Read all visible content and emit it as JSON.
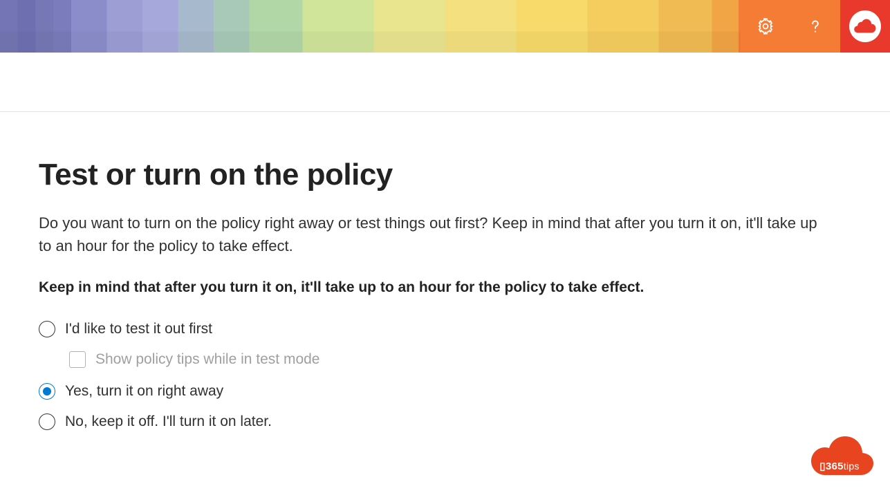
{
  "header": {
    "settings_icon": "gear",
    "help_icon": "question",
    "avatar_logo": "365tips"
  },
  "page": {
    "title": "Test or turn on the policy",
    "description": "Do you want to turn on the policy right away or test things out first? Keep in mind that after you turn it on, it'll take up to an hour for the policy to take effect.",
    "note": "Keep in mind that after you turn it on, it'll take up to an hour for the policy to take effect."
  },
  "options": {
    "test": {
      "label": "I'd like to test it out first",
      "selected": false,
      "sub": {
        "label": "Show policy tips while in test mode",
        "checked": false,
        "enabled": false
      }
    },
    "turn_on": {
      "label": "Yes, turn it on right away",
      "selected": true
    },
    "keep_off": {
      "label": "No, keep it off. I'll turn it on later.",
      "selected": false
    }
  },
  "brand": {
    "text_main": "365",
    "text_sub": "tips"
  }
}
